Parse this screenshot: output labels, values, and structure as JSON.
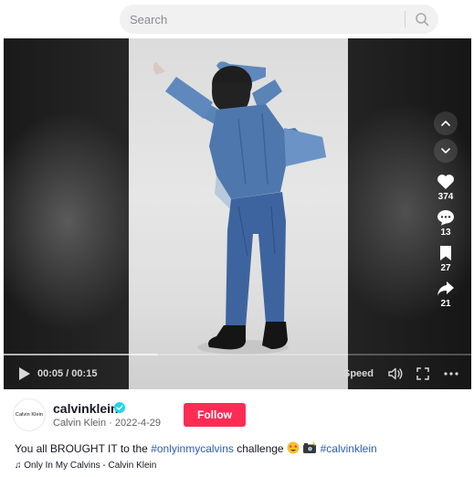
{
  "search": {
    "placeholder": "Search"
  },
  "player": {
    "time": "00:05 / 00:15",
    "speed_label": "Speed",
    "progress_fraction": 0.33,
    "actions": {
      "likes": "374",
      "comments": "13",
      "saves": "27",
      "shares": "21"
    }
  },
  "post": {
    "avatar_text": "Calvin Klein",
    "username": "calvinklein",
    "display_name": "Calvin Klein",
    "separator": " · ",
    "date": "2022-4-29",
    "follow_label": "Follow",
    "caption_prefix": "You all BROUGHT IT to the ",
    "hashtag_1": "#onlyinmycalvins",
    "caption_middle": " challenge ",
    "hashtag_2": "#calvinklein",
    "music_note": "♫",
    "music": "Only In My Calvins - Calvin Klein"
  },
  "colors": {
    "accent": "#fe2c55",
    "hashtag": "#2b5db9",
    "verified": "#20d5ec"
  },
  "icons": [
    "search-icon",
    "chevron-up-icon",
    "chevron-down-icon",
    "heart-icon",
    "comment-icon",
    "bookmark-icon",
    "share-icon",
    "play-icon",
    "volume-icon",
    "fullscreen-icon",
    "more-icon",
    "verified-icon",
    "music-note-icon"
  ]
}
